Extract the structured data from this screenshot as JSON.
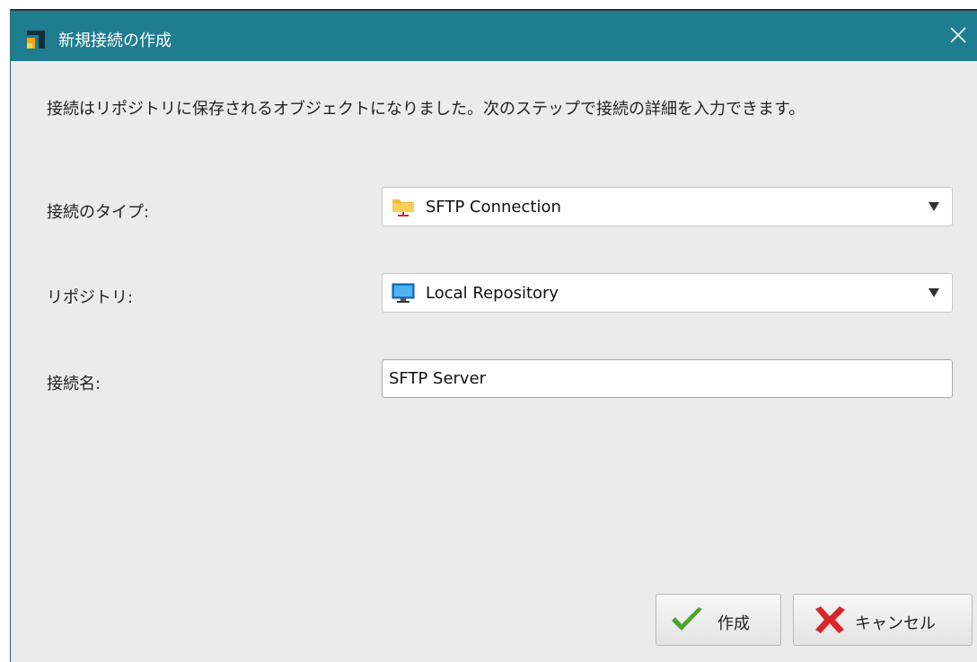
{
  "window": {
    "title": "新規接続の作成",
    "close_icon": "close-icon",
    "app_icon": "app-logo-icon"
  },
  "message": "接続はリポジトリに保存されるオブジェクトになりました。次のステップで接続の詳細を入力できます。",
  "fields": {
    "connection_type": {
      "label": "接続のタイプ:",
      "value": "SFTP Connection",
      "icon": "sftp-folder-icon"
    },
    "repository": {
      "label": "リポジトリ:",
      "value": "Local Repository",
      "icon": "monitor-icon"
    },
    "connection_name": {
      "label": "接続名:",
      "value": "SFTP Server"
    }
  },
  "buttons": {
    "create": {
      "label": "作成",
      "icon": "checkmark-icon"
    },
    "cancel": {
      "label": "キャンセル",
      "icon": "x-mark-icon"
    }
  },
  "colors": {
    "titlebar": "#1e7e8f",
    "dialog_bg": "#ebebeb",
    "check_green": "#4ea32d",
    "cancel_red": "#d9262a"
  }
}
